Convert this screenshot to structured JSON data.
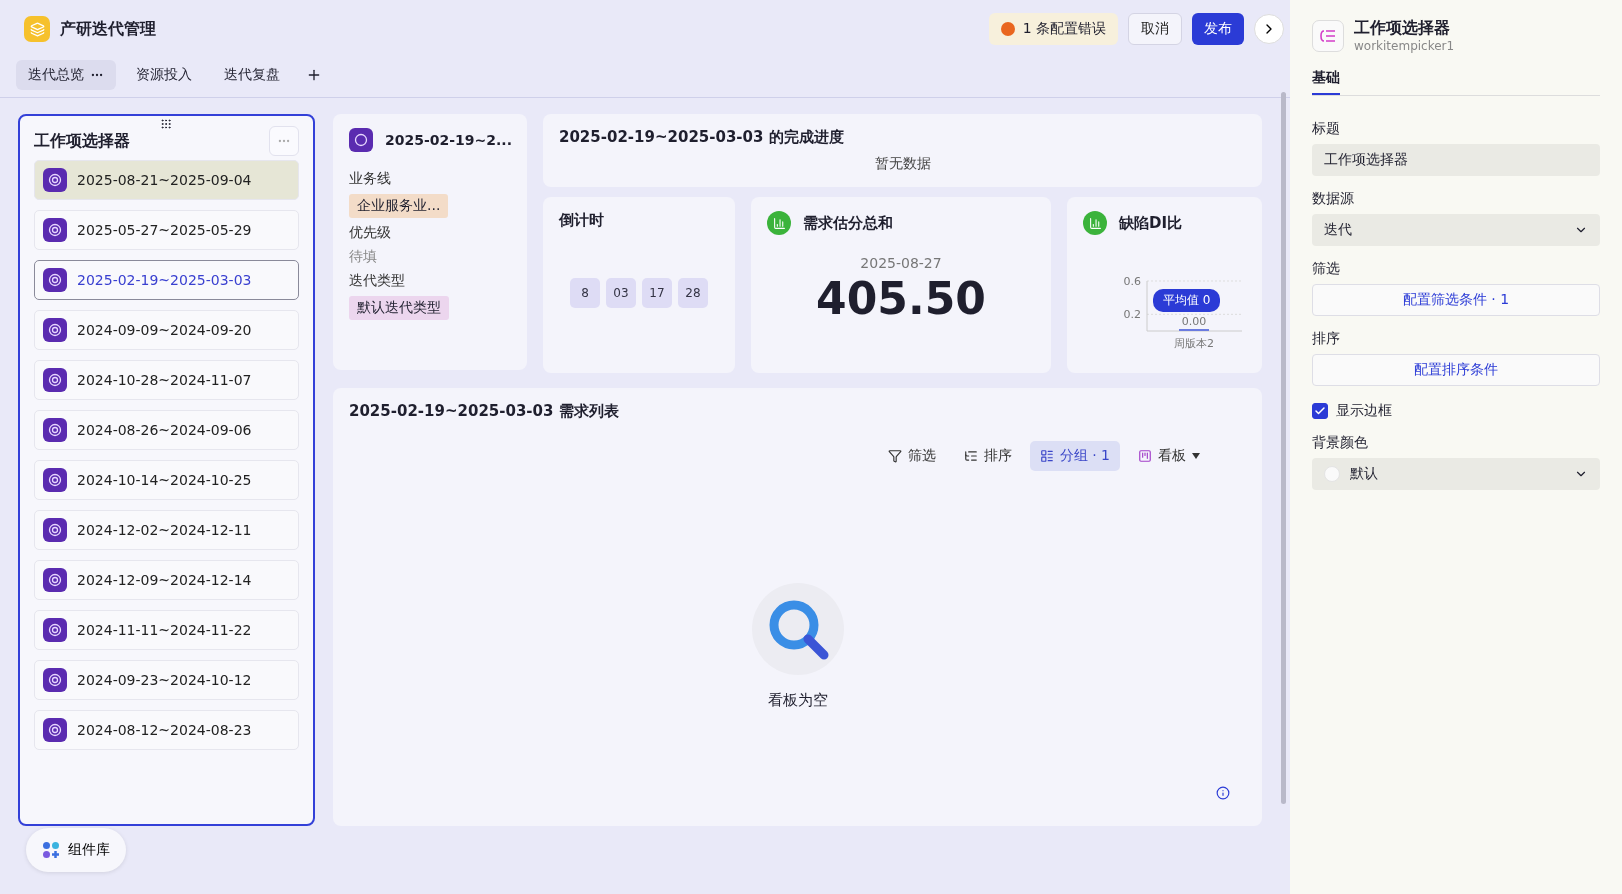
{
  "app": {
    "title": "产研迭代管理"
  },
  "header_actions": {
    "error_badge": "1 条配置错误",
    "cancel": "取消",
    "publish": "发布"
  },
  "tabs": [
    {
      "label": "迭代总览",
      "selected": true
    },
    {
      "label": "资源投入",
      "selected": false
    },
    {
      "label": "迭代复盘",
      "selected": false
    }
  ],
  "picker": {
    "title": "工作项选择器",
    "items": [
      {
        "label": "2025-08-21~2025-09-04",
        "selected": false,
        "hovered": true
      },
      {
        "label": "2025-05-27~2025-05-29",
        "selected": false,
        "hovered": false
      },
      {
        "label": "2025-02-19~2025-03-03",
        "selected": true,
        "hovered": false
      },
      {
        "label": "2024-09-09~2024-09-20",
        "selected": false,
        "hovered": false
      },
      {
        "label": "2024-10-28~2024-11-07",
        "selected": false,
        "hovered": false
      },
      {
        "label": "2024-08-26~2024-09-06",
        "selected": false,
        "hovered": false
      },
      {
        "label": "2024-10-14~2024-10-25",
        "selected": false,
        "hovered": false
      },
      {
        "label": "2024-12-02~2024-12-11",
        "selected": false,
        "hovered": false
      },
      {
        "label": "2024-12-09~2024-12-14",
        "selected": false,
        "hovered": false
      },
      {
        "label": "2024-11-11~2024-11-22",
        "selected": false,
        "hovered": false
      },
      {
        "label": "2024-09-23~2024-10-12",
        "selected": false,
        "hovered": false
      },
      {
        "label": "2024-08-12~2024-08-23",
        "selected": false,
        "hovered": false
      }
    ]
  },
  "detail_card": {
    "title": "2025-02-19~2...",
    "fields": [
      {
        "label": "业务线",
        "value": "企业服务业...",
        "kind": "tag",
        "color": "#f3dcc8"
      },
      {
        "label": "优先级",
        "value": "待填",
        "kind": "empty"
      },
      {
        "label": "迭代类型",
        "value": "默认迭代类型",
        "kind": "tag",
        "color": "#ecd6ee"
      }
    ]
  },
  "progress_card": {
    "title": "2025-02-19~2025-03-03 的完成进度",
    "empty_text": "暂无数据"
  },
  "countdown": {
    "title": "倒计时",
    "units": [
      "8",
      "03",
      "17",
      "28"
    ]
  },
  "estimate": {
    "title": "需求估分总和",
    "date": "2025-08-27",
    "value": "405.50"
  },
  "defect_ratio": {
    "title": "缺陷DI比",
    "tooltip": "平均值 0",
    "chart_data": {
      "type": "bar",
      "categories": [
        "周版本2"
      ],
      "values": [
        0
      ],
      "ylim": [
        0,
        0.6
      ],
      "yticks": [
        0.2,
        0.6
      ],
      "data_labels": true,
      "value_labels": [
        "0.00"
      ]
    }
  },
  "requirements": {
    "title": "2025-02-19~2025-03-03 需求列表",
    "toolbar": [
      {
        "label": "筛选",
        "kind": "filter",
        "selected": false
      },
      {
        "label": "排序",
        "kind": "sort",
        "selected": false
      },
      {
        "label": "分组 · 1",
        "kind": "group",
        "selected": true
      },
      {
        "label": "看板",
        "kind": "view",
        "selected": false
      }
    ],
    "empty_text": "看板为空"
  },
  "component_library": "组件库",
  "inspector": {
    "title": "工作项选择器",
    "id": "workitempicker1",
    "tabs": [
      {
        "label": "基础",
        "selected": true
      }
    ],
    "fields": [
      {
        "label": "标题",
        "kind": "input",
        "value": "工作项选择器"
      },
      {
        "label": "数据源",
        "kind": "select",
        "value": "迭代"
      },
      {
        "label": "筛选",
        "kind": "button",
        "value": "配置筛选条件 · 1"
      },
      {
        "label": "排序",
        "kind": "button",
        "value": "配置排序条件"
      },
      {
        "label": "显示边框",
        "kind": "checkbox",
        "checked": true
      },
      {
        "label": "背景颜色",
        "kind": "color_select",
        "value": "默认"
      }
    ]
  }
}
